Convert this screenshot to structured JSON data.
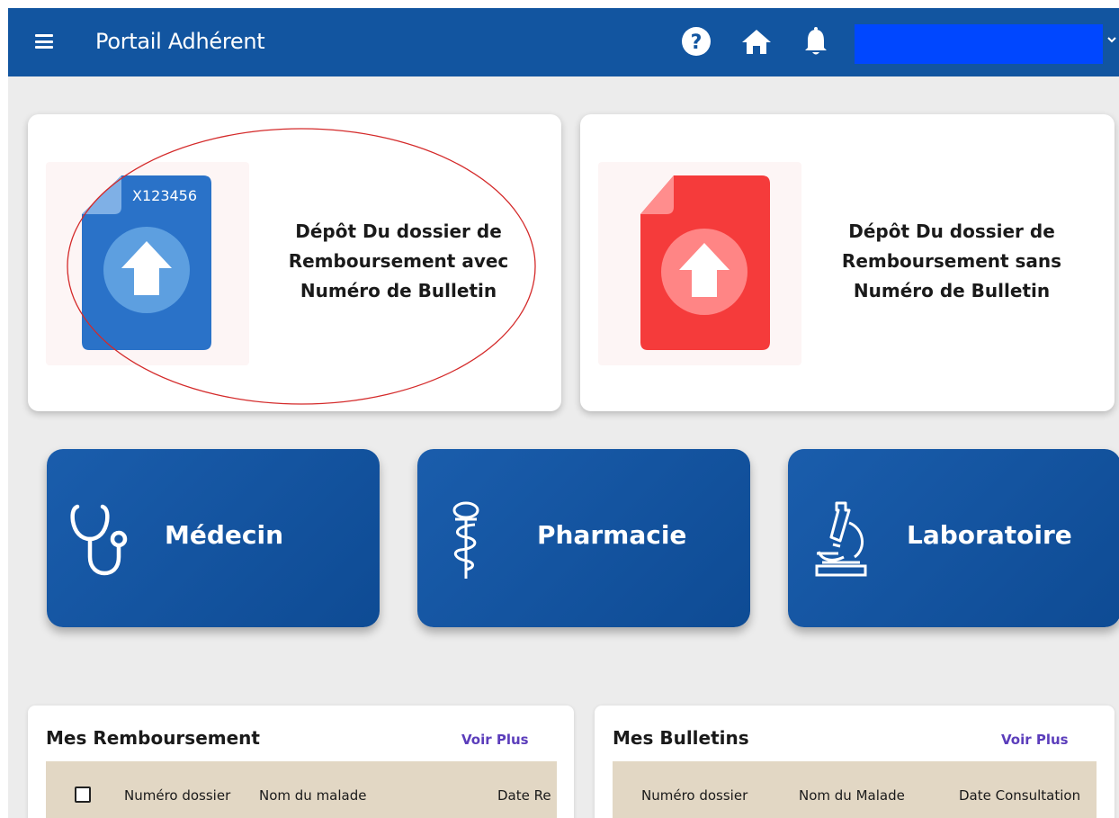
{
  "header": {
    "title": "Portail Adhérent",
    "icons": [
      "menu-icon",
      "help-icon",
      "home-icon",
      "bell-icon",
      "chevron-down-icon"
    ],
    "bar_color": "#1255a0"
  },
  "upload_cards": [
    {
      "text": "Dépôt Du dossier de Remboursement avec Numéro de Bulletin",
      "doc_number": "X123456",
      "color": "#2a72c8"
    },
    {
      "text": "Dépôt Du dossier de Remboursement sans Numéro de Bulletin",
      "color": "#f53b3b"
    }
  ],
  "tiles": [
    {
      "label": "Médecin",
      "icon": "stethoscope-icon"
    },
    {
      "label": "Pharmacie",
      "icon": "caduceus-icon"
    },
    {
      "label": "Laboratoire",
      "icon": "microscope-icon"
    }
  ],
  "panels": {
    "remboursement": {
      "title": "Mes Remboursement",
      "link": "Voir Plus",
      "columns": [
        "Numéro dossier",
        "Nom du malade",
        "Date Re"
      ]
    },
    "bulletins": {
      "title": "Mes Bulletins",
      "link": "Voir Plus",
      "columns": [
        "Numéro dossier",
        "Nom du Malade",
        "Date Consultation"
      ]
    }
  },
  "colors": {
    "tile_blue": "#1255a0",
    "link_purple": "#5b3dbb",
    "table_header": "#e2d7c4",
    "annotation_red": "#d42a2a"
  }
}
